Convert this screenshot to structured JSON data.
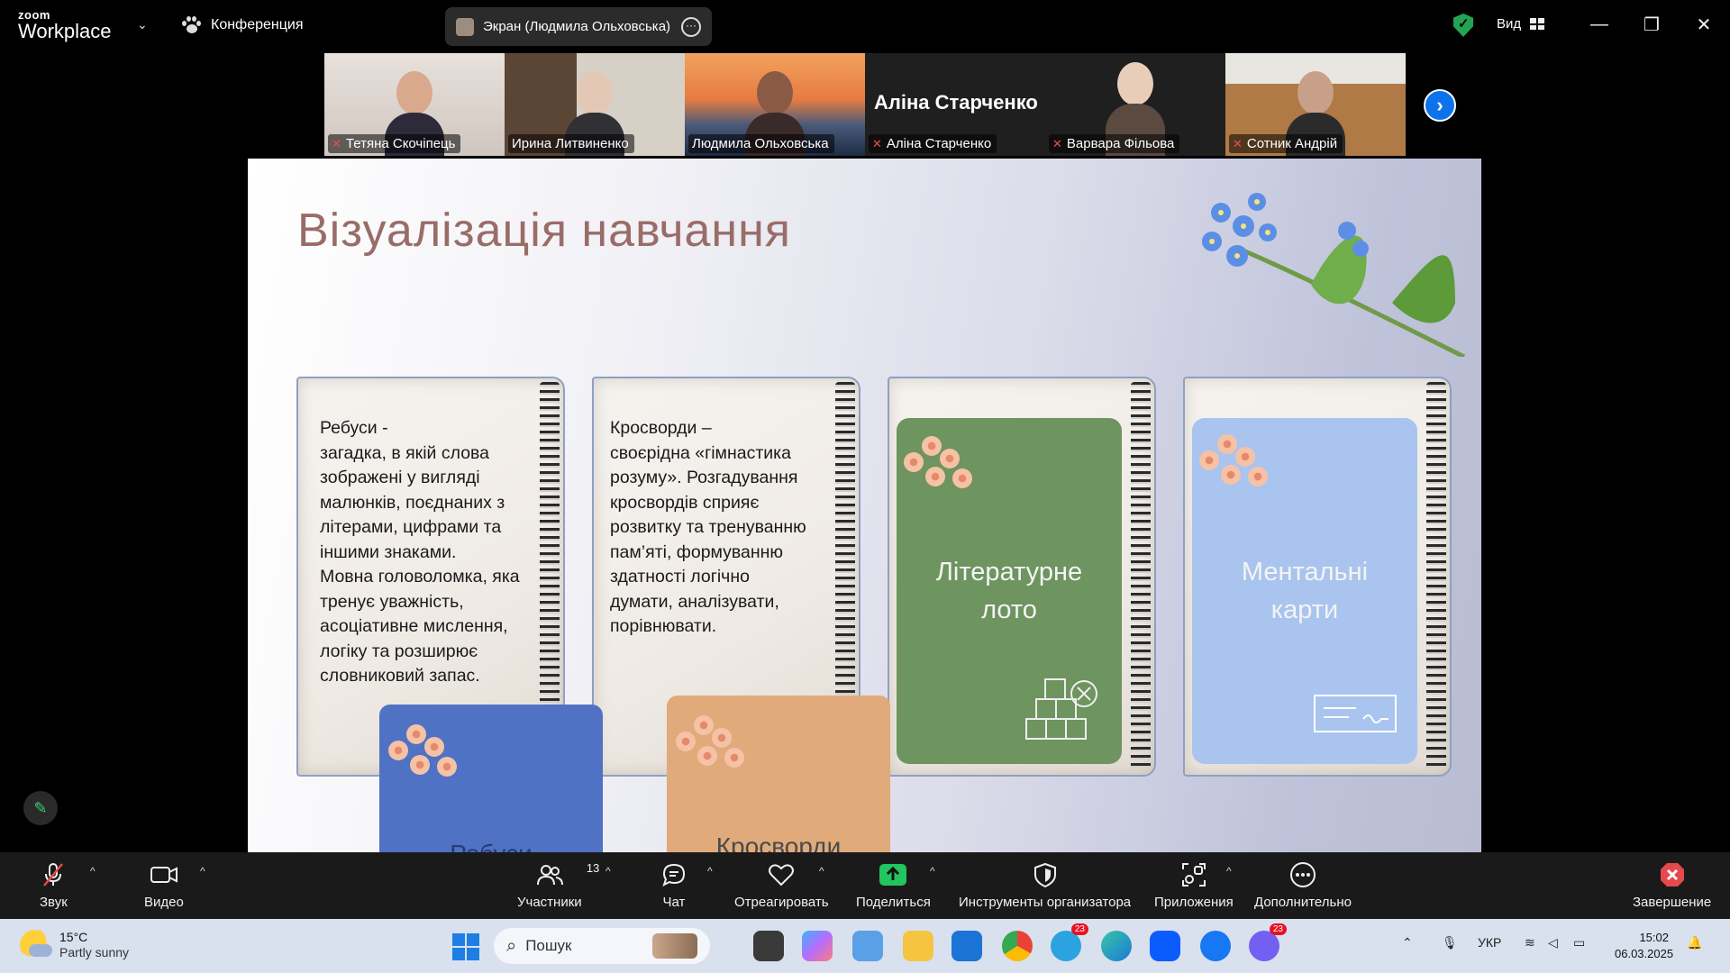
{
  "app": {
    "brand_small": "zoom",
    "brand_big": "Workplace",
    "meeting_label": "Конференция",
    "share_pill": "Экран (Людмила Ольховська)",
    "view_label": "Вид"
  },
  "participants": [
    {
      "name": "Тетяна Скочіпець",
      "muted": true,
      "active": false
    },
    {
      "name": "Ирина Литвиненко",
      "muted": false,
      "active": false
    },
    {
      "name": "Людмила Ольховська",
      "muted": false,
      "active": true
    },
    {
      "name": "Аліна Старченко",
      "muted": true,
      "active": false,
      "big_label": "Аліна Старченко"
    },
    {
      "name": "Варвара Фільова",
      "muted": true,
      "active": false
    },
    {
      "name": "Сотник Андрій",
      "muted": true,
      "active": false
    }
  ],
  "slide": {
    "title": "Візуалізація навчання",
    "notebooks": [
      {
        "text": "Ребуси -\nзагадка, в якій слова зображені у вигляді малюнків, поєднаних з літерами, цифрами та іншими знаками.\nМовна головоломка, яка тренує уважність, асоціативне мислення, логіку та розширює словниковий запас."
      },
      {
        "text": "Кросворди –\nсвоєрідна «гімнастика розуму». Розгадування кросвордів сприяє розвитку та тренуванню пам’яті,  формуванню здатності логічно думати, аналізувати, порівнювати."
      },
      {
        "card_title": "Літературне\nлото",
        "card_color": "#6e945f"
      },
      {
        "card_title": "Ментальні\nкарти",
        "card_color": "#a9c4ef"
      }
    ],
    "sticky_cards": [
      {
        "label": "Ребуси",
        "color": "#4f72c4"
      },
      {
        "label": "Кросворди",
        "color": "#e0aa7b"
      }
    ]
  },
  "toolbar": {
    "audio": "Звук",
    "video": "Видео",
    "participants": "Участники",
    "participants_count": "13",
    "chat": "Чат",
    "react": "Отреагировать",
    "share": "Поделиться",
    "host_tools": "Инструменты организатора",
    "apps": "Приложения",
    "more": "Дополнительно",
    "end": "Завершение"
  },
  "taskbar": {
    "temp": "15°C",
    "weather": "Partly sunny",
    "search_placeholder": "Пошук",
    "lang": "УКР",
    "time": "15:02",
    "date": "06.03.2025",
    "telegram_badge": "23",
    "viber_badge": "23"
  },
  "colors": {
    "accent_green": "#22c55e",
    "zoom_blue": "#0e72ed",
    "title_color": "#9a6c68",
    "end_red": "#e5484d"
  }
}
